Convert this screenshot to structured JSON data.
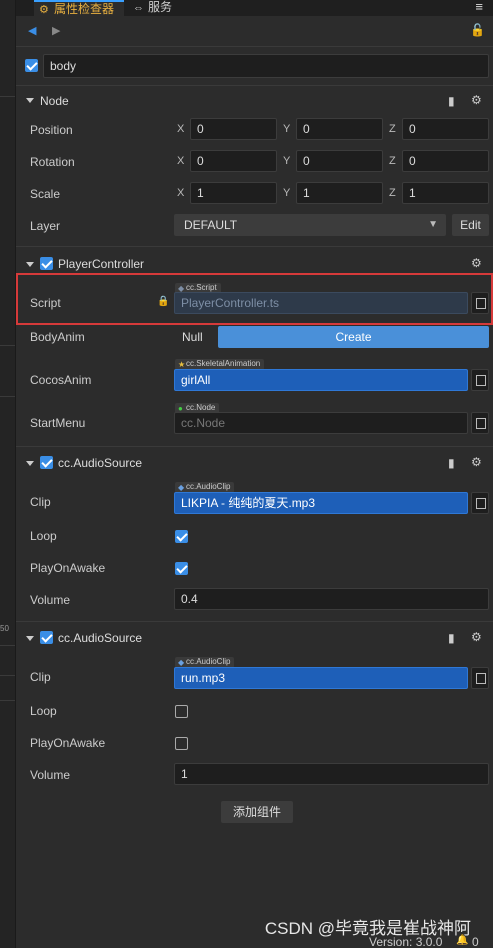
{
  "tabs": {
    "inspector": "属性检查器",
    "service": "服务"
  },
  "node": {
    "name": "body"
  },
  "section_node": {
    "title": "Node",
    "position": {
      "label": "Position",
      "x": "0",
      "y": "0",
      "z": "0"
    },
    "rotation": {
      "label": "Rotation",
      "x": "0",
      "y": "0",
      "z": "0"
    },
    "scale": {
      "label": "Scale",
      "x": "1",
      "y": "1",
      "z": "1"
    },
    "layer": {
      "label": "Layer",
      "value": "DEFAULT",
      "edit": "Edit"
    },
    "axis": {
      "x": "X",
      "y": "Y",
      "z": "Z"
    }
  },
  "player_controller": {
    "title": "PlayerController",
    "script": {
      "label": "Script",
      "tag": "cc.Script",
      "value": "PlayerController.ts"
    },
    "body_anim": {
      "label": "BodyAnim",
      "null": "Null",
      "create": "Create"
    },
    "cocos_anim": {
      "label": "CocosAnim",
      "tag": "cc.SkeletalAnimation",
      "value": "girlAll"
    },
    "start_menu": {
      "label": "StartMenu",
      "tag": "cc.Node",
      "placeholder": "cc.Node"
    }
  },
  "audio_source_1": {
    "title": "cc.AudioSource",
    "clip": {
      "label": "Clip",
      "tag": "cc.AudioClip",
      "value": "LIKPIA - 纯纯的夏天.mp3"
    },
    "loop": {
      "label": "Loop",
      "checked": true
    },
    "play_on_awake": {
      "label": "PlayOnAwake",
      "checked": true
    },
    "volume": {
      "label": "Volume",
      "value": "0.4"
    }
  },
  "audio_source_2": {
    "title": "cc.AudioSource",
    "clip": {
      "label": "Clip",
      "tag": "cc.AudioClip",
      "value": "run.mp3"
    },
    "loop": {
      "label": "Loop",
      "checked": false
    },
    "play_on_awake": {
      "label": "PlayOnAwake",
      "checked": false
    },
    "volume": {
      "label": "Volume",
      "value": "1"
    }
  },
  "add_component": "添加组件",
  "footer": {
    "version": "Version: 3.0.0",
    "notifications": "0"
  },
  "watermark": "CSDN @毕竟我是崔战神阿",
  "left_strip_label": "50",
  "colors": {
    "accent": "#3a8ee6",
    "highlight": "#d63a3a",
    "asset_blue": "#1e5fb8"
  }
}
